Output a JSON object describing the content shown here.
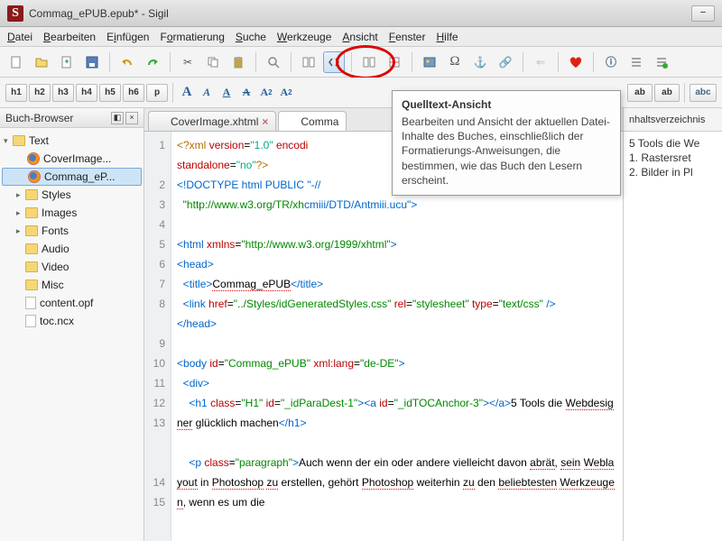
{
  "window": {
    "title": "Commag_ePUB.epub* - Sigil",
    "app_initial": "S"
  },
  "menu": {
    "items": [
      "Datei",
      "Bearbeiten",
      "Einfügen",
      "Formatierung",
      "Suche",
      "Werkzeuge",
      "Ansicht",
      "Fenster",
      "Hilfe"
    ]
  },
  "toolbar2": {
    "headings": [
      "h1",
      "h2",
      "h3",
      "h4",
      "h5",
      "h6",
      "p"
    ],
    "abc": "abc"
  },
  "sidebar": {
    "title": "Buch-Browser",
    "tree": {
      "root": "Text",
      "text_items": [
        "CoverImage...",
        "Commag_eP..."
      ],
      "folders": [
        "Styles",
        "Images",
        "Fonts",
        "Audio",
        "Video",
        "Misc"
      ],
      "files": [
        "content.opf",
        "toc.ncx"
      ]
    }
  },
  "tabs": {
    "items": [
      "CoverImage.xhtml",
      "Comma"
    ]
  },
  "tooltip": {
    "title": "Quelltext-Ansicht",
    "body": "Bearbeiten und Ansicht der aktuellen Datei-Inhalte des Buches, einschließlich der Formatierungs-Anweisungen, die bestimmen, wie das Buch den Lesern erscheint."
  },
  "rightpane": {
    "title": "nhaltsverzeichnis",
    "items": [
      "5 Tools die We",
      "  1. Rastersret",
      "  2. Bilder in Pl"
    ]
  },
  "code": {
    "lines": [
      1,
      2,
      3,
      4,
      5,
      6,
      7,
      8,
      9,
      10,
      11,
      12,
      13,
      "",
      14,
      15
    ],
    "l1a": "<?xml",
    "l1b": "version",
    "l1c": "\"1.0\"",
    "l1d": "encodi",
    "l1e": "standalone",
    "l1f": "\"no\"",
    "l1g": "?>",
    "l2": "<!DOCTYPE html PUBLIC \"-//",
    "l3a": "\"http://www.w3.org/TR/xh",
    "l3b": "\">",
    "l5a": "<",
    "l5b": "html",
    "l5c": "xmlns",
    "l5d": "\"http://www.w3.org/1999/xhtml\"",
    "l5e": ">",
    "l6a": "<",
    "l6b": "head",
    "l6c": ">",
    "l7a": "<",
    "l7b": "title",
    "l7c": ">",
    "l7d": "Commag_ePUB",
    "l7e": "</",
    "l7f": "title",
    "l7g": ">",
    "l8a": "<",
    "l8b": "link",
    "l8c": "href",
    "l8d": "\"../Styles/idGeneratedStyles.css\"",
    "l8e": "rel",
    "l8f": "\"stylesheet\"",
    "l8g": "type",
    "l8h": "\"text/css\"",
    "l8i": "/>",
    "l9a": "</",
    "l9b": "head",
    "l9c": ">",
    "l11a": "<",
    "l11b": "body",
    "l11c": "id",
    "l11d": "\"Commag_ePUB\"",
    "l11e": "xml:lang",
    "l11f": "\"de-DE\"",
    "l11g": ">",
    "l12a": "<",
    "l12b": "div",
    "l12c": ">",
    "l13a": "<",
    "l13b": "h1",
    "l13c": "class",
    "l13d": "\"H1\"",
    "l13e": "id",
    "l13f": "\"_idParaDest-1\"",
    "l13g": "><",
    "l13h": "a",
    "l13i": "id",
    "l13j": "\"_idTOCAnchor-3\"",
    "l13k": "></",
    "l13l": "a",
    "l13m": ">",
    "l13n": "5 Tools die ",
    "l13o": "Webdesigner",
    "l13p": " glücklich machen",
    "l13q": "</",
    "l13r": "h1",
    "l13s": ">",
    "l15a": "<",
    "l15b": "p",
    "l15c": "class",
    "l15d": "\"paragraph\"",
    "l15e": ">",
    "l15f": "Auch wenn der ein oder andere vielleicht davon ",
    "l15g": "abrät",
    ", ": "l15j",
    "l15i": "sein",
    "l15k": "Weblayout",
    " in ": "l15l",
    "l15m": "Photoshop",
    " ": "l15w",
    "l15o": "zu",
    " erst": "l15p",
    "l15q": " erstellen, gehört ",
    "l15r": "Photoshop",
    " weiterhin ": "l15s",
    "l15t": "zu",
    " den ": "l15u",
    "l15v": "beliebtesten",
    "l15x": "Werkzeugen",
    ", wenn es um die": "l15y"
  }
}
